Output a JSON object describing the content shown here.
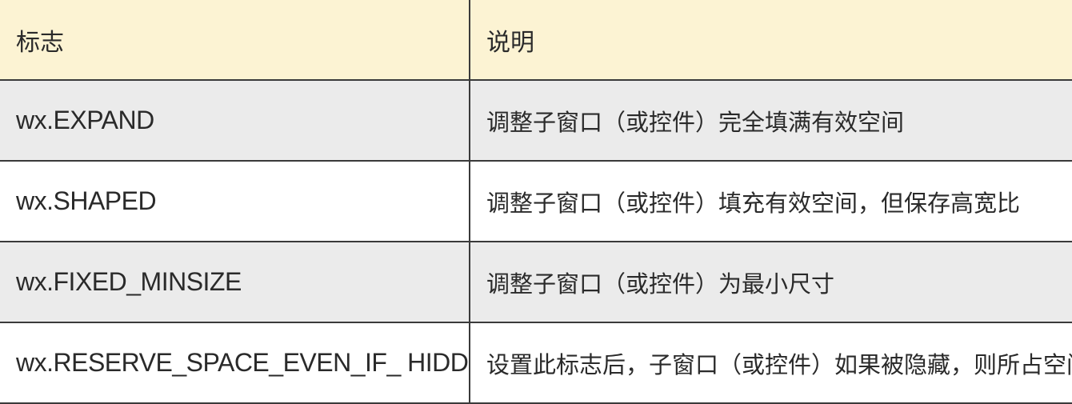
{
  "table": {
    "headers": [
      "标志",
      "说明"
    ],
    "rows": [
      {
        "flag": "wx.EXPAND",
        "desc": "调整子窗口（或控件）完全填满有效空间"
      },
      {
        "flag": "wx.SHAPED",
        "desc": "调整子窗口（或控件）填充有效空间，但保存高宽比"
      },
      {
        "flag": "wx.FIXED_MINSIZE",
        "desc": "调整子窗口（或控件）为最小尺寸"
      },
      {
        "flag": "wx.RESERVE_SPACE_EVEN_IF_ HIDDEN",
        "desc": "设置此标志后，子窗口（或控件）如果被隐藏，则所占空间保留"
      }
    ]
  },
  "colors": {
    "header_bg": "#fcf3d3",
    "alt_row_bg": "#ebebeb",
    "row_bg": "#ffffff",
    "border": "#3a3a3a"
  }
}
